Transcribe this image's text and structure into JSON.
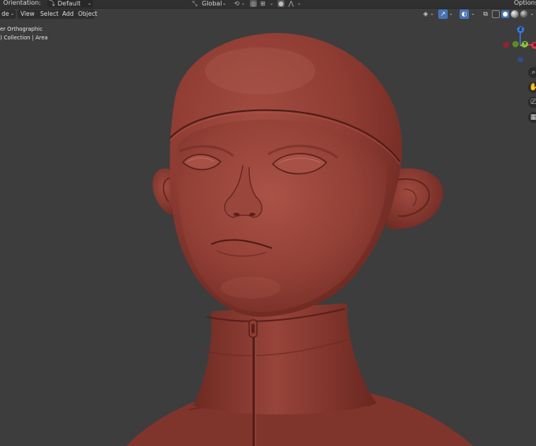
{
  "header": {
    "orientation_label": "Orientation:",
    "orientation_value": "Default",
    "transform_value": "Global",
    "options_label": "Options"
  },
  "menubar": {
    "mode_label": "de",
    "items": [
      "View",
      "Select",
      "Add",
      "Object"
    ]
  },
  "viewport": {
    "view_name": "er Orthographic",
    "collection_info": ") Collection | Area"
  },
  "gizmo": {
    "z_label": "Z",
    "x_label": "X",
    "y_label": "Y"
  },
  "colors": {
    "background": "#3d3d3d",
    "model": "#8a3a31",
    "x_axis": "#e8344b",
    "y_axis": "#8ac43a",
    "z_axis": "#3a78e0"
  },
  "icons": [
    "orientation-icon",
    "transform-icon",
    "snap-icon",
    "proportional-icon",
    "gizmo-icon",
    "overlay-icon",
    "xray-icon",
    "shading-icons",
    "zoom-icon",
    "hand-icon",
    "camera-icon",
    "grid-icon"
  ]
}
